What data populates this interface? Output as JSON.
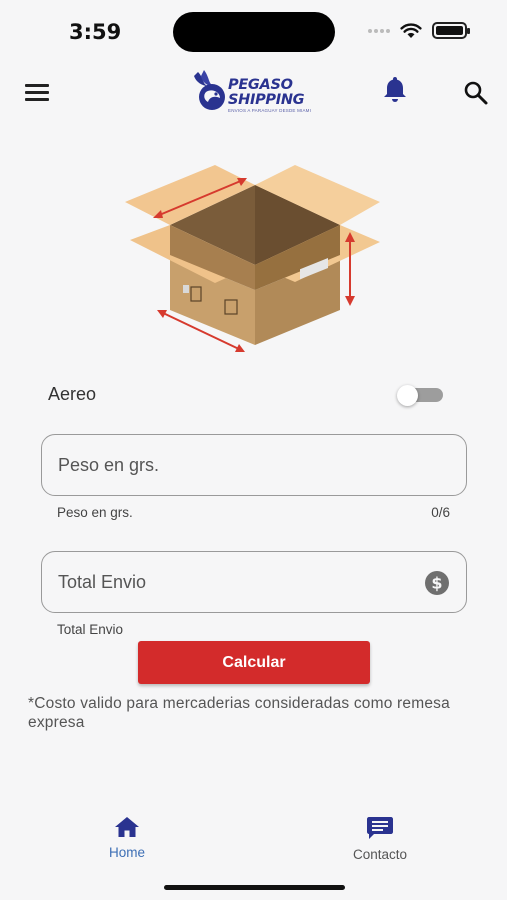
{
  "status": {
    "time": "3:59"
  },
  "header": {
    "logo_title_1": "PEGASO",
    "logo_title_2": "SHIPPING",
    "logo_subtitle": "ENVIOS A PARAGUAY DESDE MIAMI"
  },
  "form": {
    "toggle_label": "Aereo",
    "toggle_on": false,
    "peso_placeholder": "Peso en grs.",
    "peso_value": "",
    "peso_helper": "Peso en grs.",
    "peso_counter": "0/6",
    "total_placeholder": "Total Envio",
    "total_value": "",
    "total_helper": "Total Envio",
    "submit_label": "Calcular",
    "note": "*Costo valido para mercaderias consideradas como remesa expresa"
  },
  "nav": {
    "home_label": "Home",
    "contact_label": "Contacto"
  },
  "colors": {
    "brand_blue": "#2a3390",
    "accent_red": "#d32b2b",
    "active_nav": "#3d6fb5"
  }
}
